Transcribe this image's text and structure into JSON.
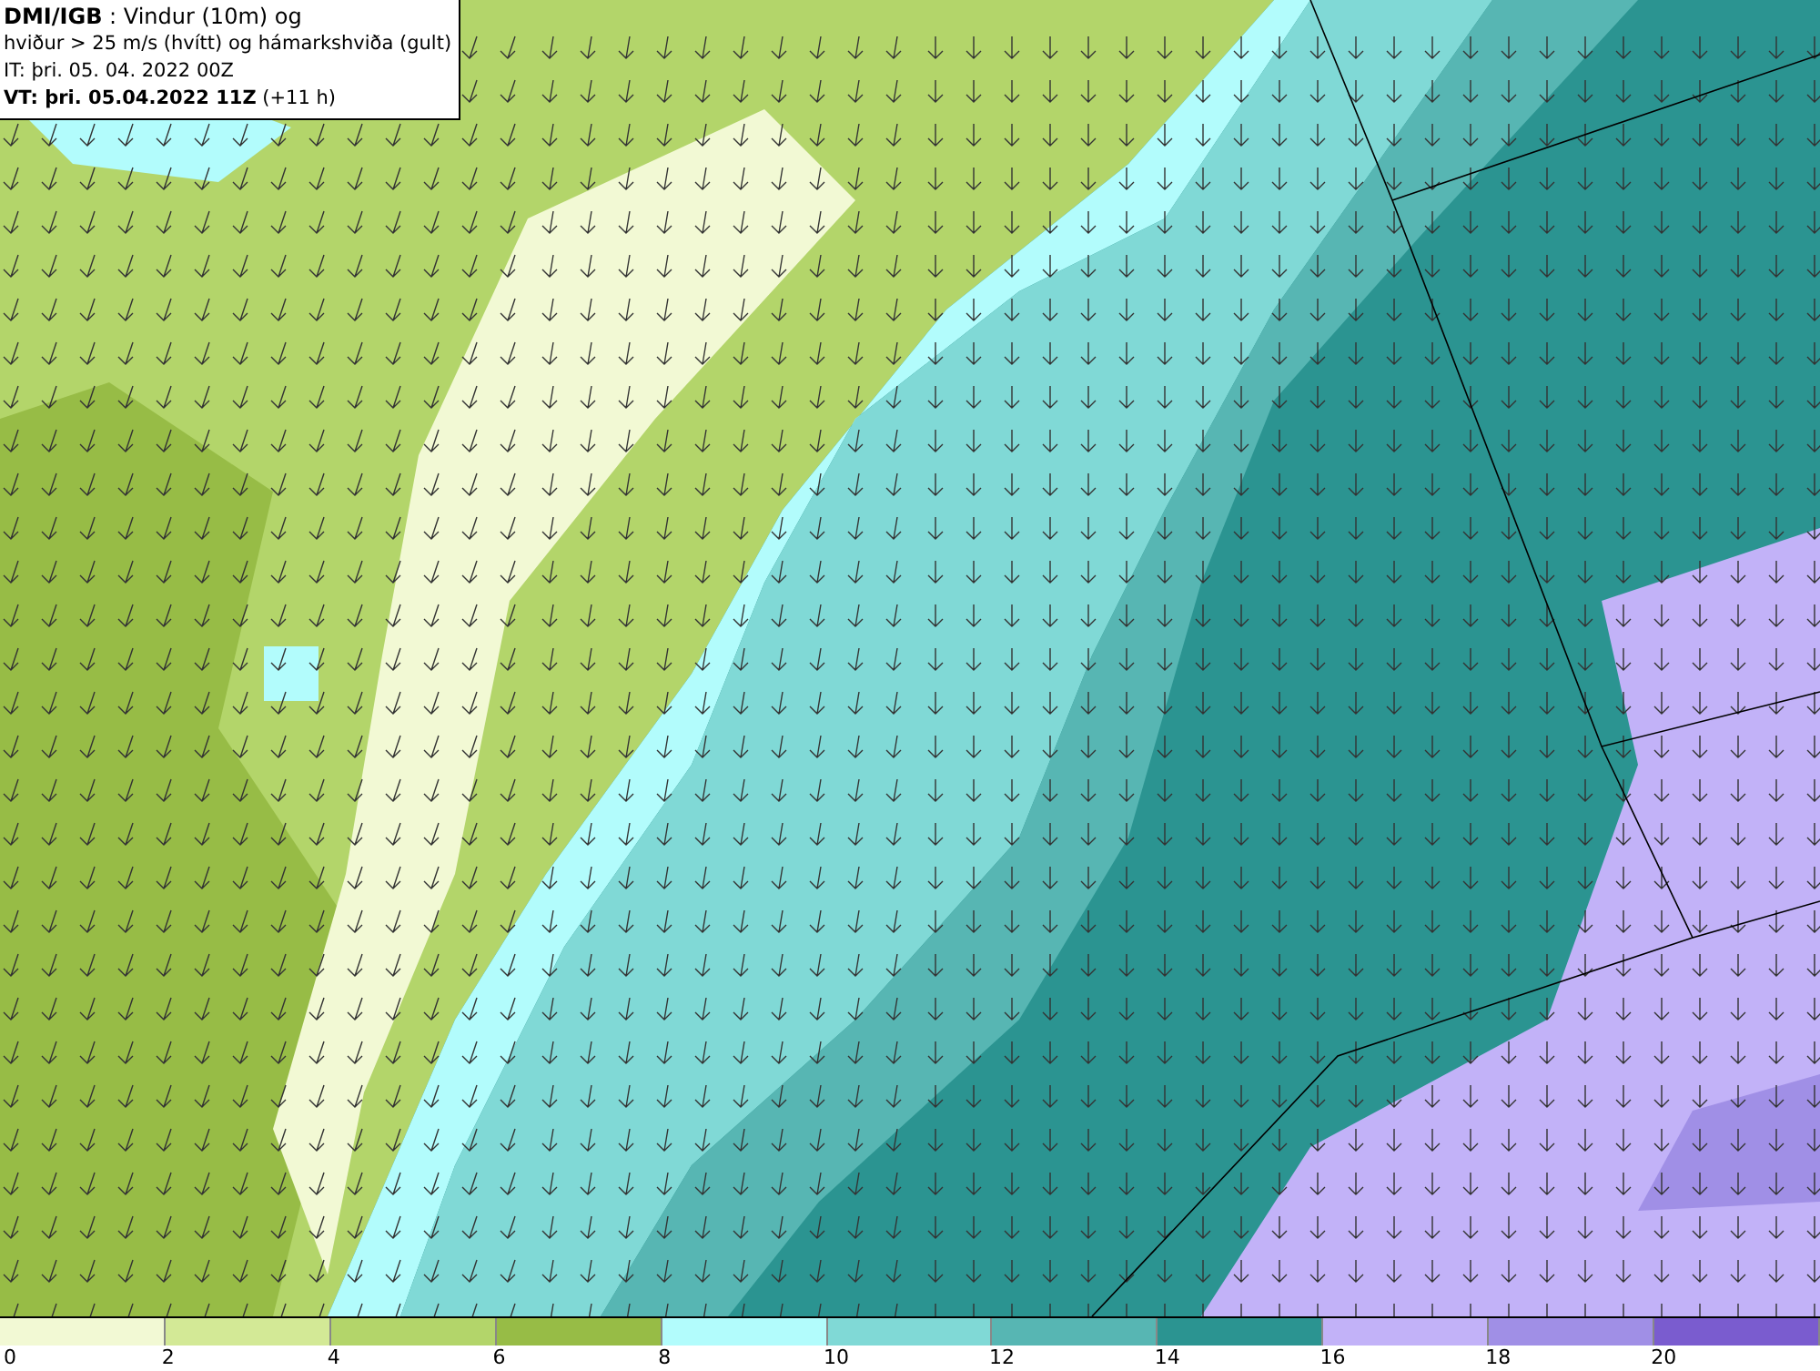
{
  "title_box": {
    "lines": [
      "**DMI/IGB** : Vindur (10m) og",
      "hviður > 25 m/s (hvítt) og hámarkshviða (gult)",
      "IT: þri. 05. 04. 2022 00Z",
      "**VT: þri. 05.04.2022 11Z** (+11 h)"
    ]
  },
  "legend": {
    "bins": [
      {
        "label": "0",
        "color": "#f2f9d4"
      },
      {
        "label": "2",
        "color": "#d3e996"
      },
      {
        "label": "4",
        "color": "#b3d56a"
      },
      {
        "label": "6",
        "color": "#97bc46"
      },
      {
        "label": "8",
        "color": "#b2fcfc"
      },
      {
        "label": "10",
        "color": "#80d9d6"
      },
      {
        "label": "12",
        "color": "#57b6b3"
      },
      {
        "label": "14",
        "color": "#2b9491"
      },
      {
        "label": "16",
        "color": "#c2b2f8"
      },
      {
        "label": "18",
        "color": "#a08fe6"
      },
      {
        "label": "20",
        "color": "#7a5ccf"
      }
    ]
  }
}
